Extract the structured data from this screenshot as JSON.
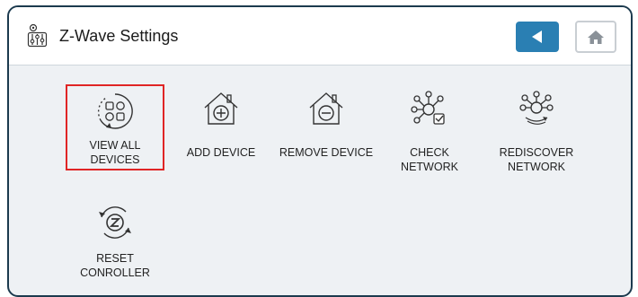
{
  "header": {
    "title": "Z-Wave Settings",
    "title_icon": "settings-sliders-icon",
    "back_icon": "back-arrow-icon",
    "home_icon": "home-icon"
  },
  "tiles": [
    {
      "label_1": "VIEW ALL",
      "label_2": "DEVICES",
      "icon": "view-all-devices-icon",
      "selected": true
    },
    {
      "label_1": "ADD DEVICE",
      "label_2": "",
      "icon": "add-device-icon",
      "selected": false
    },
    {
      "label_1": "REMOVE DEVICE",
      "label_2": "",
      "icon": "remove-device-icon",
      "selected": false
    },
    {
      "label_1": "CHECK",
      "label_2": "NETWORK",
      "icon": "check-network-icon",
      "selected": false
    },
    {
      "label_1": "REDISCOVER",
      "label_2": "NETWORK",
      "icon": "rediscover-network-icon",
      "selected": false
    },
    {
      "label_1": "RESET",
      "label_2": "CONROLLER",
      "icon": "reset-controller-icon",
      "selected": false
    }
  ],
  "colors": {
    "accent": "#2a7fb3",
    "selection": "#e02525",
    "frame_border": "#1c3a4e",
    "background": "#eef1f4"
  }
}
